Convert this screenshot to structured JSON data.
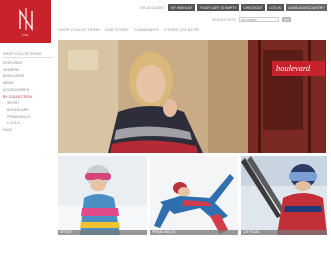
{
  "brand": {
    "name": "Nils",
    "accent": "#c8232c"
  },
  "topbar": {
    "account": "MY ACCOUNT",
    "wishlist": "MY WISHLIST",
    "cart": "YOUR CART IS EMPTY",
    "checkout": "CHECKOUT",
    "login": "LOG IN",
    "language": "LANGUAGE/COUNTRY"
  },
  "search": {
    "label": "SEARCH SITE",
    "placeholder": "KEYWORD",
    "go": "GO"
  },
  "nav": {
    "items": [
      {
        "label": "SHOP COLLECTIONS"
      },
      {
        "label": "OUR STORY"
      },
      {
        "label": "COMMUNITY"
      },
      {
        "label": "STORE LOCATOR"
      }
    ]
  },
  "sidebar": {
    "heading": "SHOP COLLECTIONS",
    "items": [
      {
        "label": "FEATURED"
      },
      {
        "label": "WOMENS"
      },
      {
        "label": "BASELAYER"
      },
      {
        "label": "MENS"
      },
      {
        "label": "ACCESSORIES"
      },
      {
        "label": "BY COLLECTION"
      },
      {
        "label": "SPORT"
      },
      {
        "label": "BOULEVARD"
      },
      {
        "label": "PRIMA BELLE"
      },
      {
        "label": "U.S.S.A."
      },
      {
        "label": "SALE"
      }
    ]
  },
  "hero": {
    "banner": "boulevard"
  },
  "tiles": [
    {
      "label": "SPORT"
    },
    {
      "label": "PRIMA BELLE"
    },
    {
      "label": "US TEAM"
    }
  ]
}
